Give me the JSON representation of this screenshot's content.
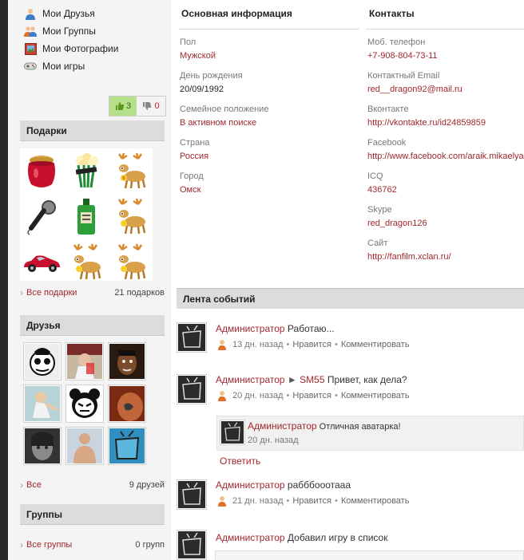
{
  "nav": [
    {
      "label": "Мои Друзья",
      "icon": "user-icon"
    },
    {
      "label": "Мои Группы",
      "icon": "group-icon"
    },
    {
      "label": "Мои Фотографии",
      "icon": "photo-icon"
    },
    {
      "label": "Мои игры",
      "icon": "gamepad-icon"
    }
  ],
  "votes": {
    "up": "3",
    "down": "0"
  },
  "gifts": {
    "title": "Подарки",
    "link": "Все подарки",
    "count": "21 подарков",
    "items": [
      "jam-jar",
      "popcorn",
      "moose",
      "microphone",
      "perfume-bottle",
      "moose",
      "sports-car",
      "moose",
      "moose"
    ]
  },
  "friends": {
    "title": "Друзья",
    "link": "Все",
    "count": "9 друзей"
  },
  "groups": {
    "title": "Группы",
    "link": "Все группы",
    "count": "0 групп"
  },
  "basic": {
    "title": "Основная информация",
    "fields": [
      {
        "label": "Пол",
        "value": "Мужской",
        "link": true
      },
      {
        "label": "День рождения",
        "value": "20/09/1992",
        "link": false
      },
      {
        "label": "Семейное положение",
        "value": "В активном поиске",
        "link": true
      },
      {
        "label": "Страна",
        "value": "Россия",
        "link": true
      },
      {
        "label": "Город",
        "value": "Омск",
        "link": true
      }
    ]
  },
  "contacts": {
    "title": "Контакты",
    "fields": [
      {
        "label": "Моб. телефон",
        "value": "+7-908-804-73-11"
      },
      {
        "label": "Контактный Email",
        "value": "red__dragon92@mail.ru"
      },
      {
        "label": "Вконтакте",
        "value": "http://vkontakte.ru/id24859859"
      },
      {
        "label": "Facebook",
        "value": "http://www.facebook.com/araik.mikaelya"
      },
      {
        "label": "ICQ",
        "value": "436762"
      },
      {
        "label": "Skype",
        "value": "red_dragon126"
      },
      {
        "label": "Сайт",
        "value": "http://fanfilm.xclan.ru/"
      }
    ]
  },
  "feed": {
    "title": "Лента событий",
    "like": "Нравится",
    "comment": "Комментировать",
    "reply": "Ответить",
    "posts": [
      {
        "author": "Администратор",
        "text": "Работаю...",
        "time": "13 дн. назад"
      },
      {
        "author": "Администратор",
        "arrow": "►",
        "target": "SM55",
        "text": "Привет, как дела?",
        "time": "20 дн. назад"
      },
      {
        "author": "Администратор",
        "text": "рабббооотааа",
        "time": "21 дн. назад"
      },
      {
        "author": "Администратор",
        "text": "Добавил игру в список"
      }
    ],
    "nested_comment": {
      "author": "Администратор",
      "text": "Отличная аватарка!",
      "time": "20 дн. назад"
    }
  }
}
